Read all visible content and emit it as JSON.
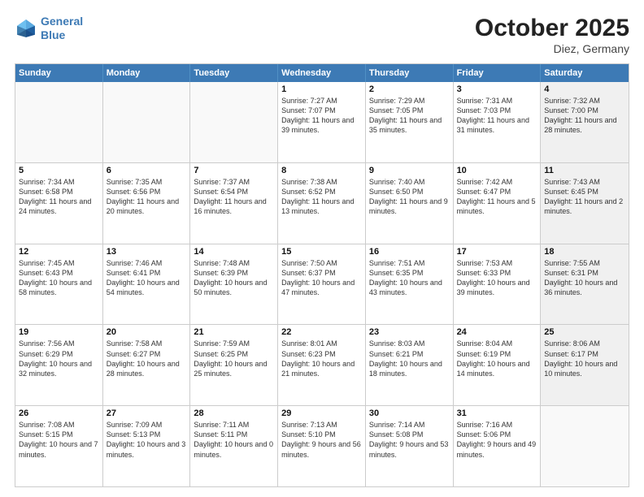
{
  "header": {
    "logo_line1": "General",
    "logo_line2": "Blue",
    "main_title": "October 2025",
    "subtitle": "Diez, Germany"
  },
  "calendar": {
    "days": [
      "Sunday",
      "Monday",
      "Tuesday",
      "Wednesday",
      "Thursday",
      "Friday",
      "Saturday"
    ],
    "rows": [
      [
        {
          "day": "",
          "text": "",
          "empty": true
        },
        {
          "day": "",
          "text": "",
          "empty": true
        },
        {
          "day": "",
          "text": "",
          "empty": true
        },
        {
          "day": "1",
          "text": "Sunrise: 7:27 AM\nSunset: 7:07 PM\nDaylight: 11 hours\nand 39 minutes."
        },
        {
          "day": "2",
          "text": "Sunrise: 7:29 AM\nSunset: 7:05 PM\nDaylight: 11 hours\nand 35 minutes."
        },
        {
          "day": "3",
          "text": "Sunrise: 7:31 AM\nSunset: 7:03 PM\nDaylight: 11 hours\nand 31 minutes."
        },
        {
          "day": "4",
          "text": "Sunrise: 7:32 AM\nSunset: 7:00 PM\nDaylight: 11 hours\nand 28 minutes.",
          "shaded": true
        }
      ],
      [
        {
          "day": "5",
          "text": "Sunrise: 7:34 AM\nSunset: 6:58 PM\nDaylight: 11 hours\nand 24 minutes."
        },
        {
          "day": "6",
          "text": "Sunrise: 7:35 AM\nSunset: 6:56 PM\nDaylight: 11 hours\nand 20 minutes."
        },
        {
          "day": "7",
          "text": "Sunrise: 7:37 AM\nSunset: 6:54 PM\nDaylight: 11 hours\nand 16 minutes."
        },
        {
          "day": "8",
          "text": "Sunrise: 7:38 AM\nSunset: 6:52 PM\nDaylight: 11 hours\nand 13 minutes."
        },
        {
          "day": "9",
          "text": "Sunrise: 7:40 AM\nSunset: 6:50 PM\nDaylight: 11 hours\nand 9 minutes."
        },
        {
          "day": "10",
          "text": "Sunrise: 7:42 AM\nSunset: 6:47 PM\nDaylight: 11 hours\nand 5 minutes."
        },
        {
          "day": "11",
          "text": "Sunrise: 7:43 AM\nSunset: 6:45 PM\nDaylight: 11 hours\nand 2 minutes.",
          "shaded": true
        }
      ],
      [
        {
          "day": "12",
          "text": "Sunrise: 7:45 AM\nSunset: 6:43 PM\nDaylight: 10 hours\nand 58 minutes."
        },
        {
          "day": "13",
          "text": "Sunrise: 7:46 AM\nSunset: 6:41 PM\nDaylight: 10 hours\nand 54 minutes."
        },
        {
          "day": "14",
          "text": "Sunrise: 7:48 AM\nSunset: 6:39 PM\nDaylight: 10 hours\nand 50 minutes."
        },
        {
          "day": "15",
          "text": "Sunrise: 7:50 AM\nSunset: 6:37 PM\nDaylight: 10 hours\nand 47 minutes."
        },
        {
          "day": "16",
          "text": "Sunrise: 7:51 AM\nSunset: 6:35 PM\nDaylight: 10 hours\nand 43 minutes."
        },
        {
          "day": "17",
          "text": "Sunrise: 7:53 AM\nSunset: 6:33 PM\nDaylight: 10 hours\nand 39 minutes."
        },
        {
          "day": "18",
          "text": "Sunrise: 7:55 AM\nSunset: 6:31 PM\nDaylight: 10 hours\nand 36 minutes.",
          "shaded": true
        }
      ],
      [
        {
          "day": "19",
          "text": "Sunrise: 7:56 AM\nSunset: 6:29 PM\nDaylight: 10 hours\nand 32 minutes."
        },
        {
          "day": "20",
          "text": "Sunrise: 7:58 AM\nSunset: 6:27 PM\nDaylight: 10 hours\nand 28 minutes."
        },
        {
          "day": "21",
          "text": "Sunrise: 7:59 AM\nSunset: 6:25 PM\nDaylight: 10 hours\nand 25 minutes."
        },
        {
          "day": "22",
          "text": "Sunrise: 8:01 AM\nSunset: 6:23 PM\nDaylight: 10 hours\nand 21 minutes."
        },
        {
          "day": "23",
          "text": "Sunrise: 8:03 AM\nSunset: 6:21 PM\nDaylight: 10 hours\nand 18 minutes."
        },
        {
          "day": "24",
          "text": "Sunrise: 8:04 AM\nSunset: 6:19 PM\nDaylight: 10 hours\nand 14 minutes."
        },
        {
          "day": "25",
          "text": "Sunrise: 8:06 AM\nSunset: 6:17 PM\nDaylight: 10 hours\nand 10 minutes.",
          "shaded": true
        }
      ],
      [
        {
          "day": "26",
          "text": "Sunrise: 7:08 AM\nSunset: 5:15 PM\nDaylight: 10 hours\nand 7 minutes."
        },
        {
          "day": "27",
          "text": "Sunrise: 7:09 AM\nSunset: 5:13 PM\nDaylight: 10 hours\nand 3 minutes."
        },
        {
          "day": "28",
          "text": "Sunrise: 7:11 AM\nSunset: 5:11 PM\nDaylight: 10 hours\nand 0 minutes."
        },
        {
          "day": "29",
          "text": "Sunrise: 7:13 AM\nSunset: 5:10 PM\nDaylight: 9 hours\nand 56 minutes."
        },
        {
          "day": "30",
          "text": "Sunrise: 7:14 AM\nSunset: 5:08 PM\nDaylight: 9 hours\nand 53 minutes."
        },
        {
          "day": "31",
          "text": "Sunrise: 7:16 AM\nSunset: 5:06 PM\nDaylight: 9 hours\nand 49 minutes."
        },
        {
          "day": "",
          "text": "",
          "empty": true,
          "shaded": true
        }
      ]
    ]
  }
}
